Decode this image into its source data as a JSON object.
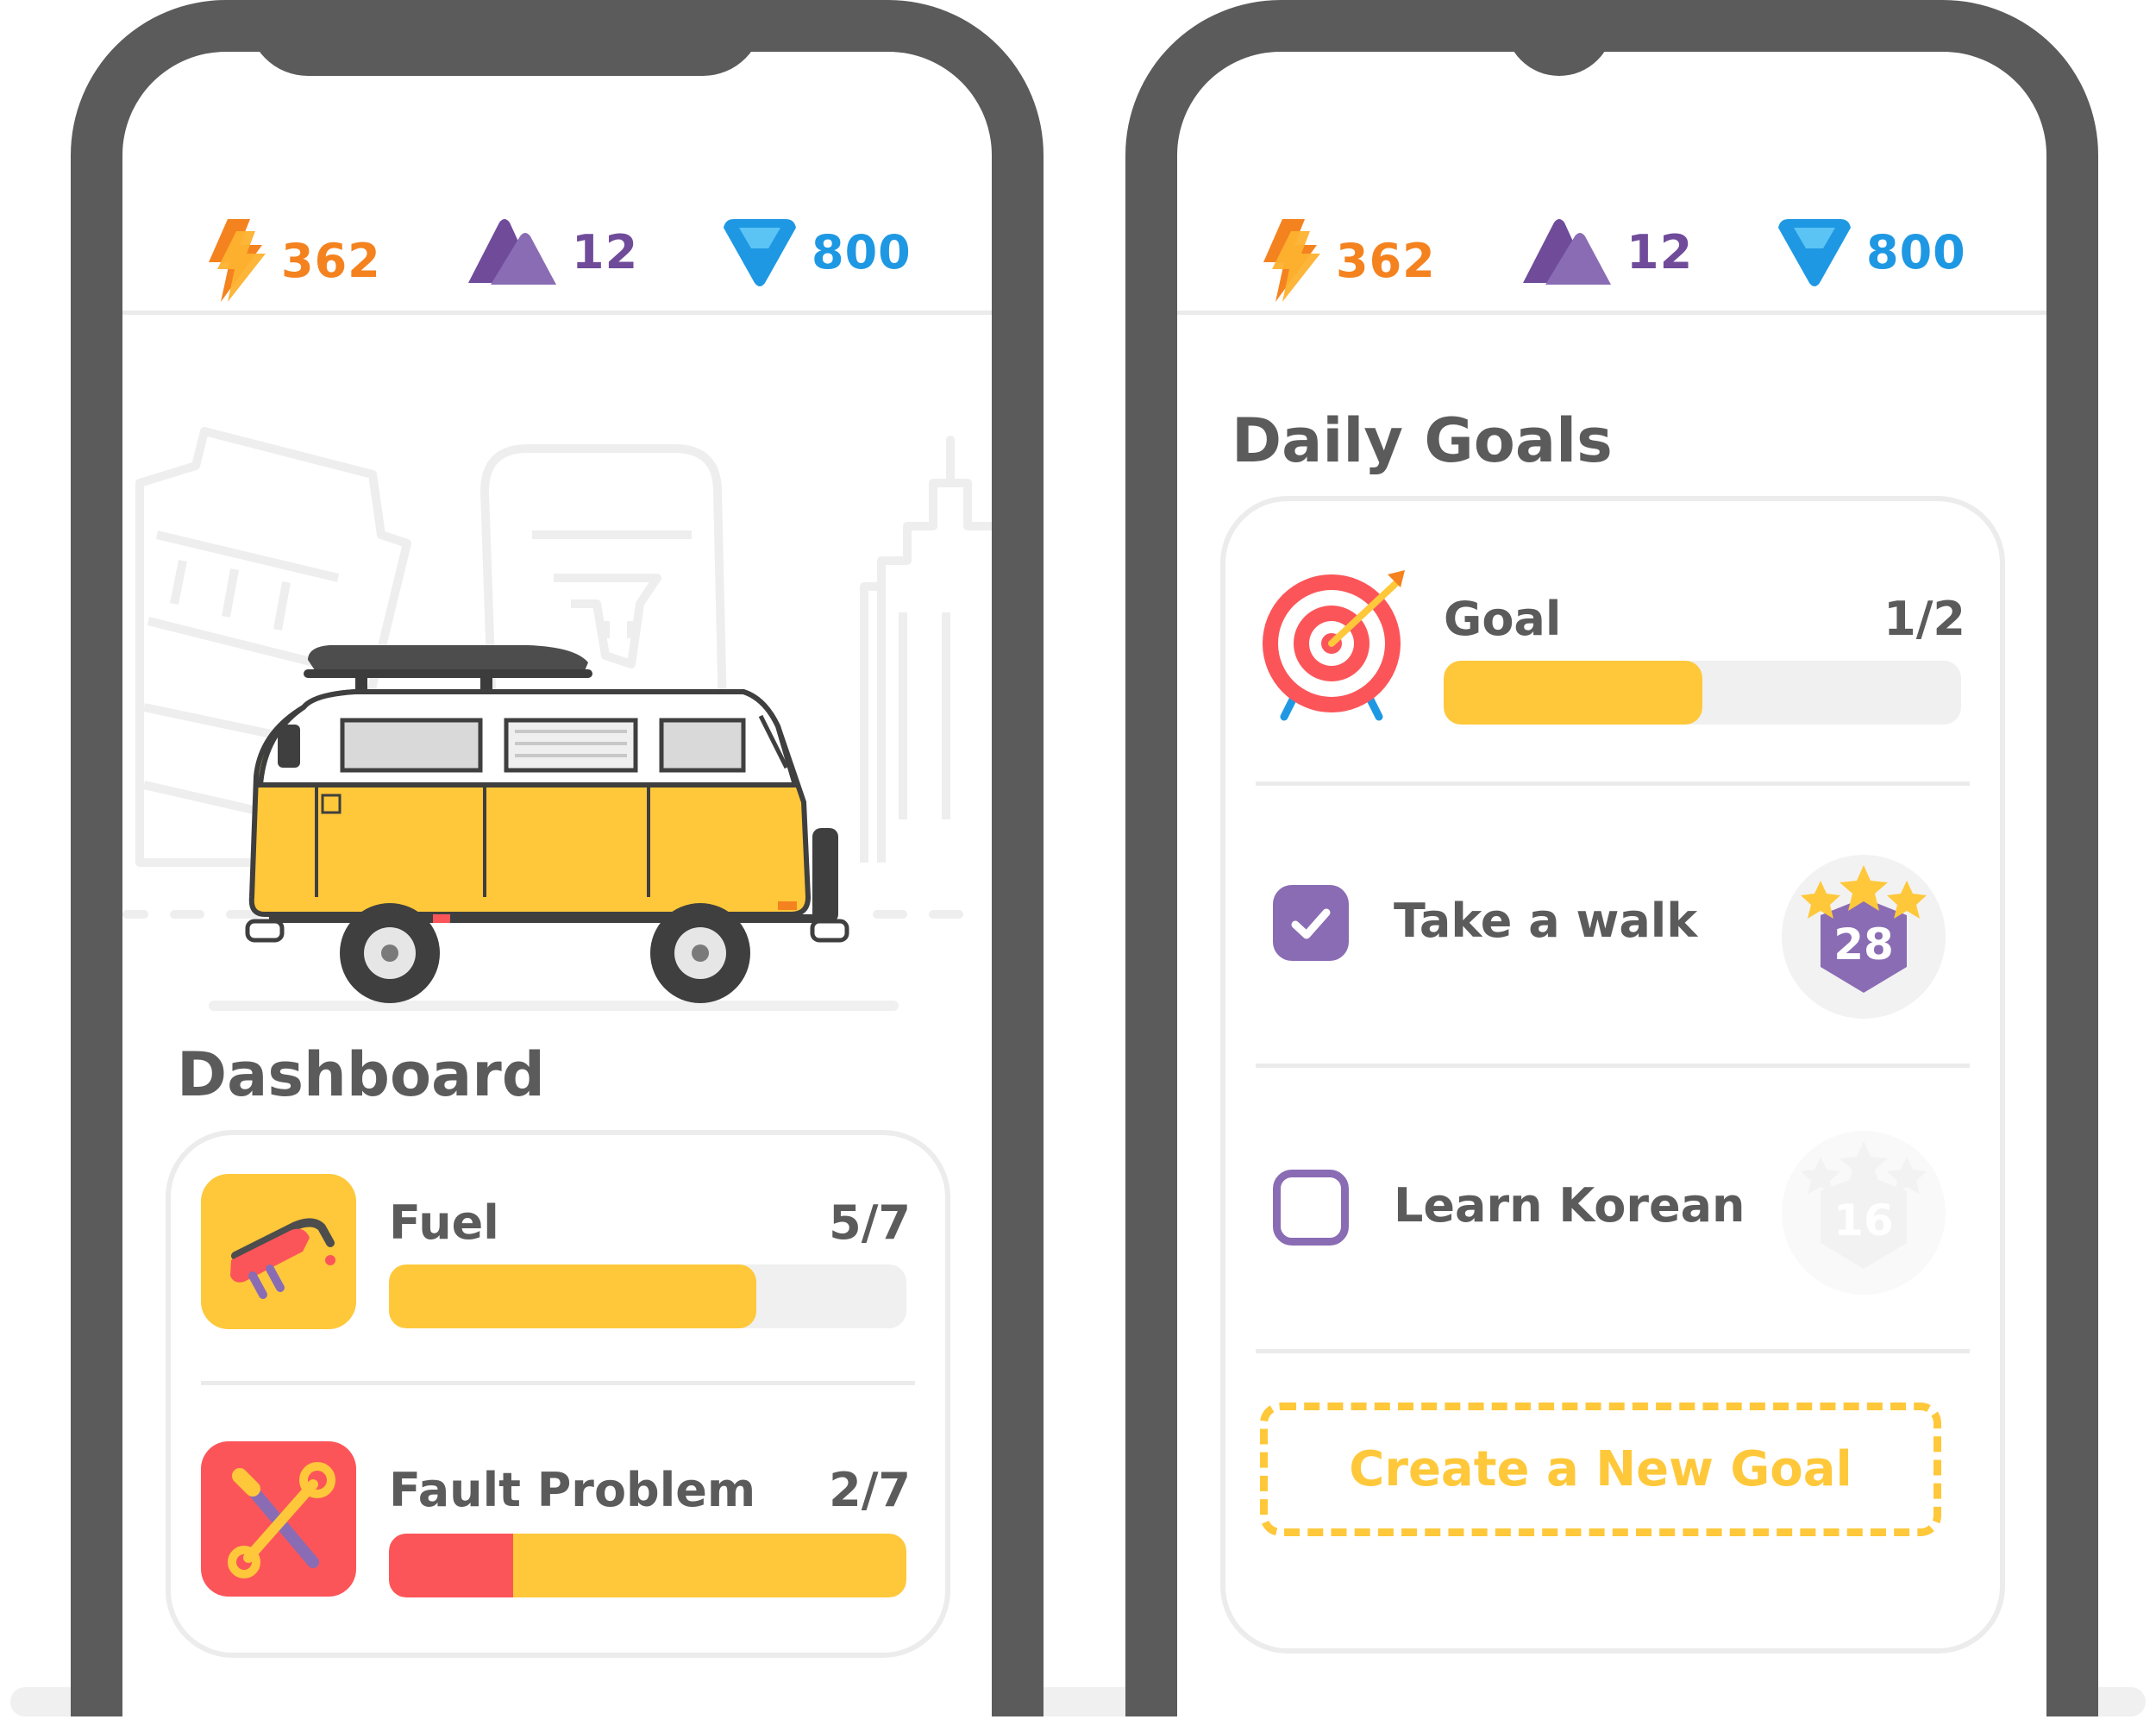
{
  "currency": {
    "energy": "362",
    "gems": "12",
    "diamonds": "800",
    "colors": {
      "energy": "#f4821f",
      "gems": "#6f4b9a",
      "diamonds": "#1f98e3"
    }
  },
  "left_screen": {
    "illustration": "camper-van-icon",
    "dashboard": {
      "title": "Dashboard",
      "items": [
        {
          "label": "Fuel",
          "count": "5/7",
          "progress": 0.71,
          "icon": "fuel-nozzle-icon"
        },
        {
          "label": "Fault Problem",
          "count": "2/7",
          "progress": 1.0,
          "fault_fraction": 0.24,
          "icon": "wrench-screwdriver-icon"
        }
      ]
    }
  },
  "right_screen": {
    "title": "Daily Goals",
    "goal": {
      "label": "Goal",
      "count": "1/2",
      "progress": 0.5,
      "icon": "target-arrow-icon"
    },
    "tasks": [
      {
        "label": "Take a walk",
        "checked": true,
        "badge": "28",
        "badge_active": true
      },
      {
        "label": "Learn Korean",
        "checked": false,
        "badge": "16",
        "badge_active": false
      }
    ],
    "create_label": "Create a New Goal"
  },
  "theme": {
    "accent": "#fec83a",
    "danger": "#fc5559",
    "purple": "#8a6cb4",
    "frame": "#5b5b5b"
  }
}
